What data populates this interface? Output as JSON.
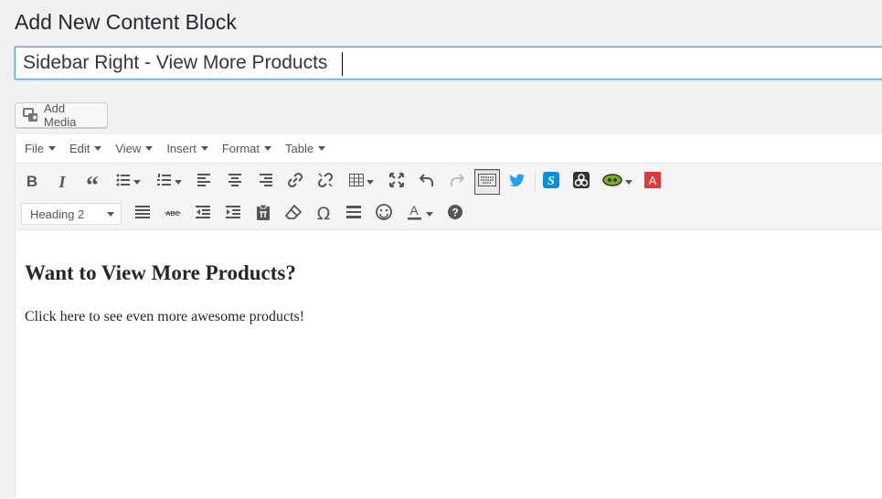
{
  "page": {
    "title": "Add New Content Block"
  },
  "title_field": {
    "value": "Sidebar Right - View More Products"
  },
  "add_media": {
    "label": "Add Media"
  },
  "menubar": {
    "items": [
      {
        "label": "File"
      },
      {
        "label": "Edit"
      },
      {
        "label": "View"
      },
      {
        "label": "Insert"
      },
      {
        "label": "Format"
      },
      {
        "label": "Table"
      }
    ]
  },
  "toolbar": {
    "row1": [
      "bold-icon",
      "italic-icon",
      "blockquote-icon",
      "bullet-list-icon",
      "numbered-list-icon",
      "align-left-icon",
      "align-center-icon",
      "align-right-icon",
      "link-icon",
      "unlink-icon",
      "table-icon",
      "fullscreen-icon",
      "undo-icon",
      "redo-icon",
      "keyboard-icon",
      "twitter-icon",
      "s-plugin-icon",
      "shortcode-icon",
      "rocket-icon",
      "acrobat-icon"
    ],
    "format_select": "Heading 2",
    "row2": [
      "justify-icon",
      "strikethrough-icon",
      "outdent-icon",
      "indent-icon",
      "paste-text-icon",
      "clear-formatting-icon",
      "special-character-icon",
      "horizontal-line-icon",
      "emoticon-icon",
      "text-color-icon",
      "help-icon"
    ]
  },
  "content": {
    "heading": "Want to View More Products?",
    "paragraph": "Click here to see even more awesome products!"
  },
  "colors": {
    "twitter": "#1da1f2",
    "s_plugin": "#0b8ed9",
    "acrobat": "#e0383b",
    "rocket": "#7bb31a",
    "focus_border": "#5b9dd9"
  }
}
